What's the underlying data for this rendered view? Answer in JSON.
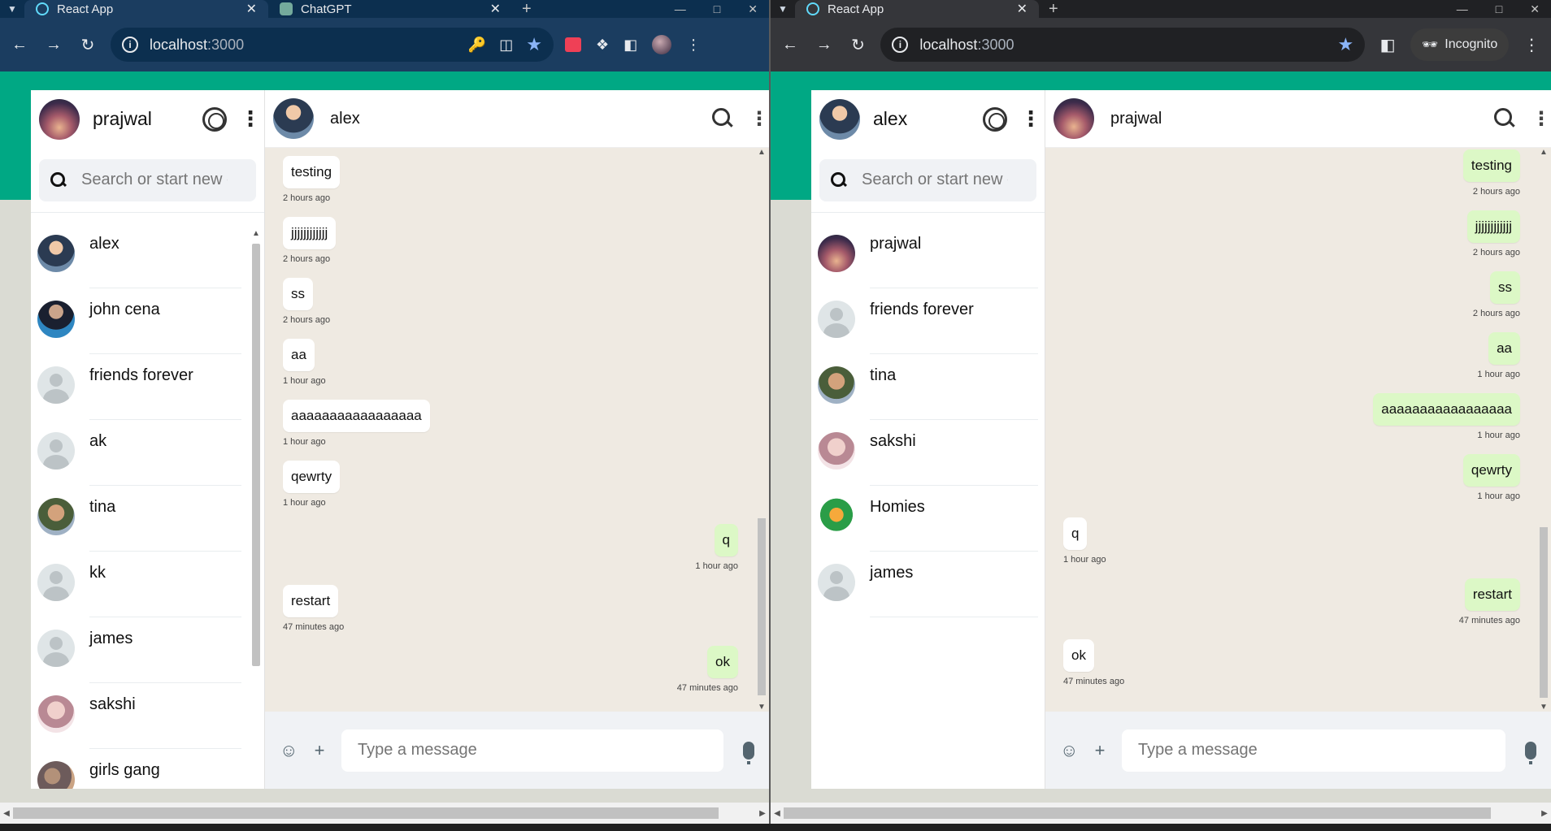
{
  "left_window": {
    "tabs": [
      {
        "title": "React App",
        "favicon": "react-icon"
      },
      {
        "title": "ChatGPT",
        "favicon": "chatgpt-icon"
      }
    ],
    "url_host": "localhost",
    "url_port": ":3000",
    "user": {
      "name": "prajwal",
      "avatar": "sunset-avatar"
    },
    "search_placeholder": "Search or start new chat",
    "chats": [
      {
        "name": "alex",
        "avatar": "av-man"
      },
      {
        "name": "john cena",
        "avatar": "av-john"
      },
      {
        "name": "friends forever",
        "avatar": "default"
      },
      {
        "name": "ak",
        "avatar": "default"
      },
      {
        "name": "tina",
        "avatar": "av-tina"
      },
      {
        "name": "kk",
        "avatar": "default"
      },
      {
        "name": "james",
        "avatar": "default"
      },
      {
        "name": "sakshi",
        "avatar": "av-sakshi"
      },
      {
        "name": "girls gang",
        "avatar": "av-girls"
      }
    ],
    "conversation": {
      "contact_name": "alex",
      "messages": [
        {
          "text": "testing",
          "time": "2 hours ago",
          "sent": false
        },
        {
          "text": "jjjjjjjjjjjj",
          "time": "2 hours ago",
          "sent": false
        },
        {
          "text": "ss",
          "time": "2 hours ago",
          "sent": false
        },
        {
          "text": "aa",
          "time": "1 hour ago",
          "sent": false
        },
        {
          "text": "aaaaaaaaaaaaaaaaa",
          "time": "1 hour ago",
          "sent": false
        },
        {
          "text": "qewrty",
          "time": "1 hour ago",
          "sent": false
        },
        {
          "text": "q",
          "time": "1 hour ago",
          "sent": true
        },
        {
          "text": "restart",
          "time": "47 minutes ago",
          "sent": false
        },
        {
          "text": "ok",
          "time": "47 minutes ago",
          "sent": true
        }
      ],
      "input_placeholder": "Type a message"
    }
  },
  "right_window": {
    "tabs": [
      {
        "title": "React App",
        "favicon": "react-icon"
      }
    ],
    "url_host": "localhost",
    "url_port": ":3000",
    "incognito_label": "Incognito",
    "user": {
      "name": "alex",
      "avatar": "man-avatar"
    },
    "search_placeholder": "Search or start new chat",
    "chats": [
      {
        "name": "prajwal",
        "avatar": "av-sunset"
      },
      {
        "name": "friends forever",
        "avatar": "default"
      },
      {
        "name": "tina",
        "avatar": "av-tina"
      },
      {
        "name": "sakshi",
        "avatar": "av-sakshi"
      },
      {
        "name": "Homies",
        "avatar": "av-homies"
      },
      {
        "name": "james",
        "avatar": "default"
      }
    ],
    "conversation": {
      "contact_name": "prajwal",
      "messages": [
        {
          "text": "testing",
          "time": "2 hours ago",
          "sent": true
        },
        {
          "text": "jjjjjjjjjjjj",
          "time": "2 hours ago",
          "sent": true
        },
        {
          "text": "ss",
          "time": "2 hours ago",
          "sent": true
        },
        {
          "text": "aa",
          "time": "1 hour ago",
          "sent": true
        },
        {
          "text": "aaaaaaaaaaaaaaaaa",
          "time": "1 hour ago",
          "sent": true
        },
        {
          "text": "qewrty",
          "time": "1 hour ago",
          "sent": true
        },
        {
          "text": "q",
          "time": "1 hour ago",
          "sent": false
        },
        {
          "text": "restart",
          "time": "47 minutes ago",
          "sent": true
        },
        {
          "text": "ok",
          "time": "47 minutes ago",
          "sent": false
        }
      ],
      "input_placeholder": "Type a message"
    }
  },
  "colors": {
    "accent_band": "#00a884",
    "sent_bubble": "#dcf8c6",
    "received_bubble": "#ffffff",
    "chat_background": "#efeae2"
  }
}
